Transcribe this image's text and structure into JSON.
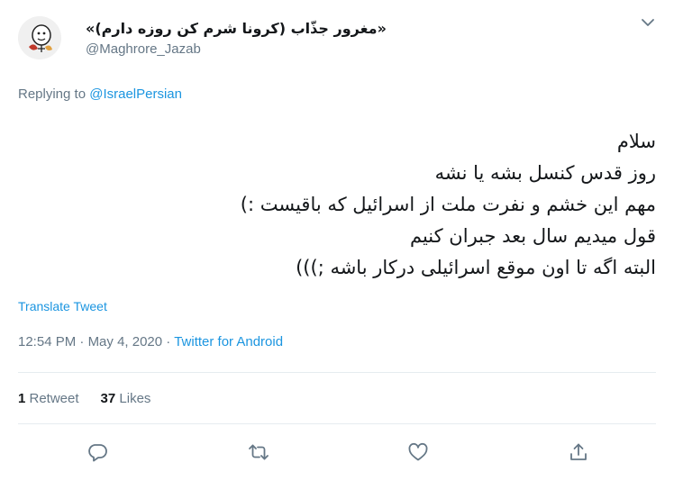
{
  "user": {
    "display_name": "«مغرور جذّاب (کرونا شرم کن روزه دارم)»",
    "handle": "@Maghrore_Jazab"
  },
  "reply": {
    "prefix": "Replying to ",
    "to_handle": "@IsraelPersian"
  },
  "tweet": {
    "lines": [
      "سلام",
      "روز قدس کنسل بشه یا نشه",
      "مهم این خشم و نفرت ملت از اسرائیل که باقیست :)",
      "قول میدیم سال بعد جبران کنیم",
      "البته اگه تا اون موقع اسرائیلی درکار باشه ;)))"
    ],
    "translate_label": "Translate Tweet"
  },
  "meta": {
    "time": "12:54 PM",
    "sep1": " · ",
    "date": "May 4, 2020",
    "sep2": " · ",
    "source": "Twitter for Android"
  },
  "stats": {
    "retweets_count": "1",
    "retweets_label": " Retweet",
    "likes_count": "37",
    "likes_label": " Likes"
  },
  "icons": {
    "caret": "chevron-down-icon",
    "reply": "reply-icon",
    "retweet": "retweet-icon",
    "like": "heart-icon",
    "share": "share-icon"
  },
  "colors": {
    "link": "#1b95e0",
    "secondary": "#657786",
    "text": "#14171a",
    "divider": "#e6ecf0"
  }
}
